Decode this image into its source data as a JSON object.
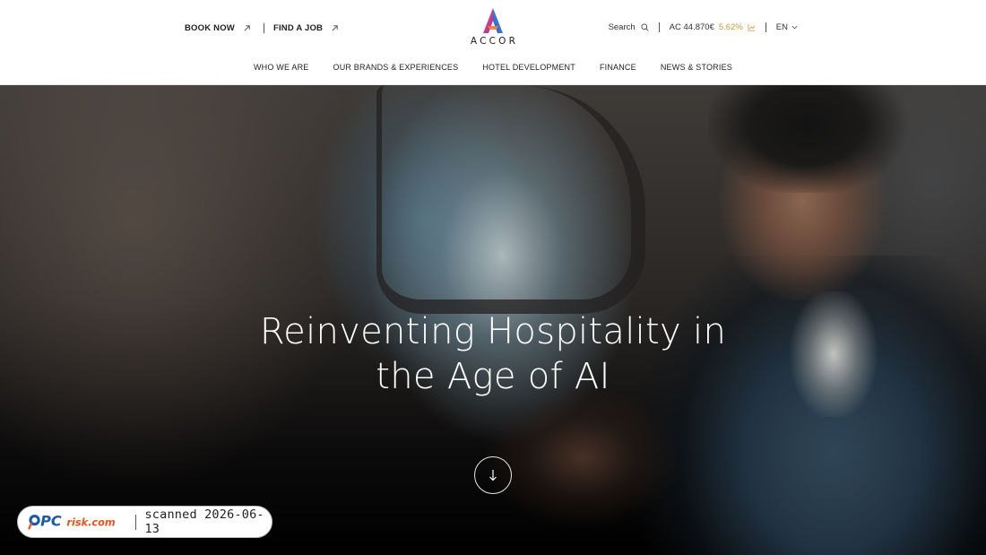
{
  "header": {
    "book_now": "BOOK NOW",
    "find_a_job": "FIND A JOB",
    "logo_text": "ACCOR",
    "search_label": "Search",
    "stock_ticker": "AC 44.870€",
    "stock_change": "5.62%",
    "language": "EN"
  },
  "nav": {
    "items": [
      {
        "label": "WHO WE ARE"
      },
      {
        "label": "OUR BRANDS & EXPERIENCES"
      },
      {
        "label": "HOTEL DEVELOPMENT"
      },
      {
        "label": "FINANCE"
      },
      {
        "label": "NEWS & STORIES"
      }
    ]
  },
  "hero": {
    "title_line1": "Reinventing Hospitality in",
    "title_line2": "the Age of AI"
  },
  "watermark": {
    "logo_text": "PCrisk.com",
    "scanned_text": "scanned 2026-06-13"
  },
  "colors": {
    "accent_gold": "#c69a3d",
    "header_bg": "#ffffff",
    "hero_text": "#ffffff"
  },
  "icons": [
    "arrow-up-right-icon",
    "search-icon",
    "chart-icon",
    "chevron-down-icon",
    "arrow-down-icon"
  ]
}
